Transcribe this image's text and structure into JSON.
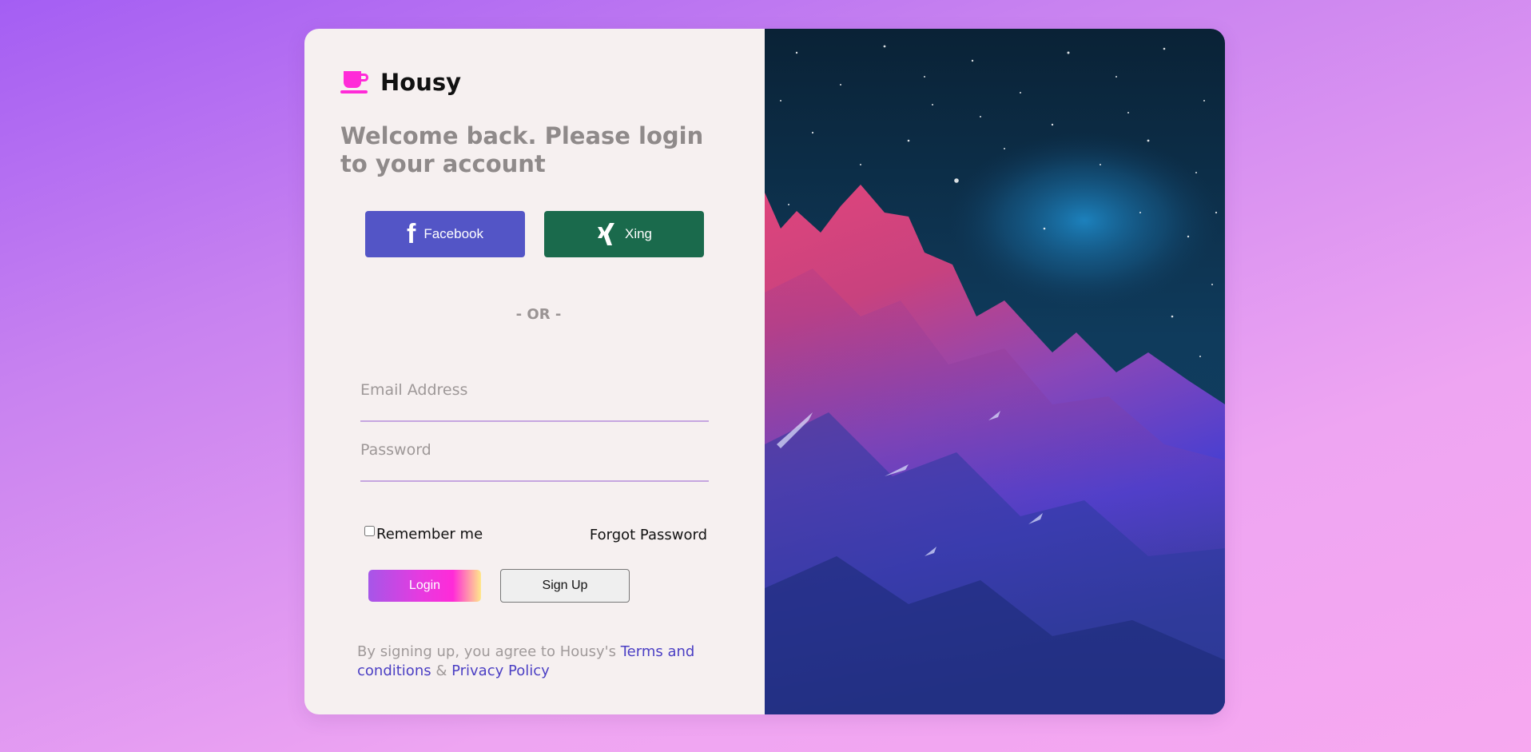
{
  "brand": {
    "name": "Housy",
    "icon": "coffee-cup-icon",
    "color": "#ff2bd8"
  },
  "login": {
    "welcome": "Welcome back. Please login to your account",
    "social": {
      "facebook": {
        "label": "Facebook",
        "icon": "facebook-icon",
        "color": "#5355c6"
      },
      "xing": {
        "label": "Xing",
        "icon": "xing-icon",
        "color": "#1a6a4c"
      }
    },
    "divider": "- OR -",
    "email_placeholder": "Email Address",
    "password_placeholder": "Password",
    "remember_label": "Remember me",
    "forgot_label": "Forgot Password",
    "login_label": "Login",
    "signup_label": "Sign Up",
    "terms": {
      "prefix": "By signing up, you agree to Housy's ",
      "terms_link": "Terms and conditions",
      "separator": " & ",
      "privacy_link": "Privacy Policy"
    }
  },
  "hero": {
    "description_icon": "mountain-night-sky-image"
  }
}
